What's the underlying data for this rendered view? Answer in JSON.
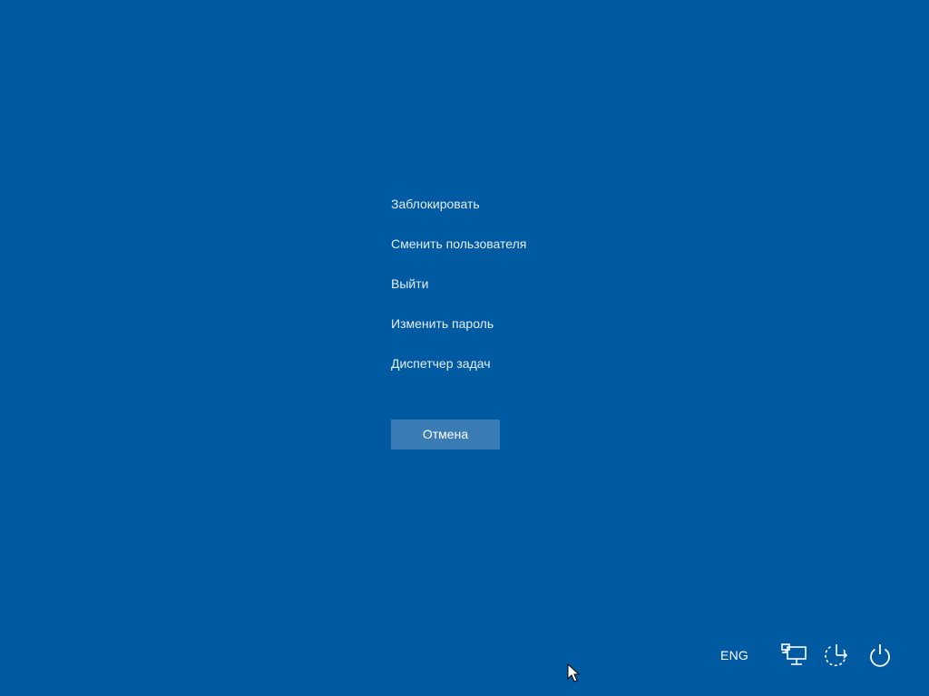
{
  "menu": {
    "items": [
      {
        "id": "lock",
        "label": "Заблокировать"
      },
      {
        "id": "switch-user",
        "label": "Сменить пользователя"
      },
      {
        "id": "sign-out",
        "label": "Выйти"
      },
      {
        "id": "change-password",
        "label": "Изменить пароль"
      },
      {
        "id": "task-manager",
        "label": "Диспетчер задач"
      }
    ]
  },
  "cancel_label": "Отмена",
  "tray": {
    "language": "ENG",
    "icons": [
      "network-icon",
      "ease-of-access-icon",
      "power-icon"
    ]
  },
  "colors": {
    "background": "#005aa1",
    "button": "#3a7cb6",
    "text": "#ffffff"
  }
}
